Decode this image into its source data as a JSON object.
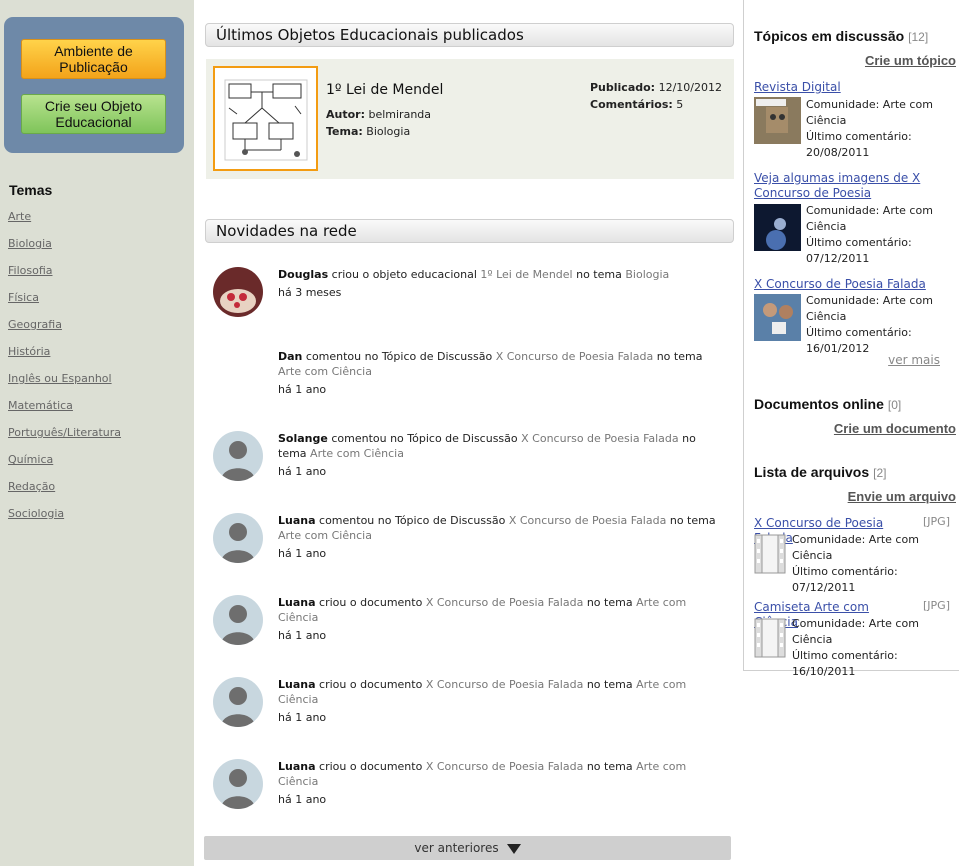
{
  "sidebar": {
    "publish_button": "Ambiente de Publicação",
    "create_button": "Crie seu Objeto Educacional",
    "temas_heading": "Temas",
    "temas": [
      "Arte",
      "Biologia",
      "Filosofia",
      "Física",
      "Geografia",
      "História",
      "Inglês ou Espanhol",
      "Matemática",
      "Português/Literatura",
      "Química",
      "Redação",
      "Sociologia"
    ]
  },
  "objects": {
    "heading": "Últimos Objetos Educacionais publicados",
    "item": {
      "title": "1º Lei de Mendel",
      "autor_label": "Autor:",
      "autor": "belmiranda",
      "tema_label": "Tema:",
      "tema": "Biologia",
      "published_label": "Publicado:",
      "published": "12/10/2012",
      "comments_label": "Comentários:",
      "comments": "5"
    }
  },
  "news": {
    "heading": "Novidades na rede",
    "items": [
      {
        "user": "Douglas",
        "action": "criou o objeto educacional",
        "target": "1º Lei de Mendel",
        "connector": "no tema",
        "theme": "Biologia",
        "time": "há 3 meses",
        "avatar": "photo"
      },
      {
        "user": "Dan",
        "action": "comentou no Tópico de Discussão",
        "target": "X Concurso de Poesia Falada",
        "connector": "no tema",
        "theme": "Arte com Ciência",
        "time": "há 1 ano",
        "avatar": "none"
      },
      {
        "user": "Solange",
        "action": "comentou no Tópico de Discussão",
        "target": "X Concurso de Poesia Falada",
        "connector": "no tema",
        "theme": "Arte com Ciência",
        "time": "há 1 ano",
        "avatar": "default"
      },
      {
        "user": "Luana",
        "action": "comentou no Tópico de Discussão",
        "target": "X Concurso de Poesia Falada",
        "connector": "no tema",
        "theme": "Arte com Ciência",
        "time": "há 1 ano",
        "avatar": "default"
      },
      {
        "user": "Luana",
        "action": "criou o documento",
        "target": "X Concurso de Poesia Falada",
        "connector": "no tema",
        "theme": "Arte com Ciência",
        "time": "há 1 ano",
        "avatar": "default"
      },
      {
        "user": "Luana",
        "action": "criou o documento",
        "target": "X Concurso de Poesia Falada",
        "connector": "no tema",
        "theme": "Arte com Ciência",
        "time": "há 1 ano",
        "avatar": "default"
      },
      {
        "user": "Luana",
        "action": "criou o documento",
        "target": "X Concurso de Poesia Falada",
        "connector": "no tema",
        "theme": "Arte com Ciência",
        "time": "há 1 ano",
        "avatar": "default"
      }
    ],
    "older_button": "ver anteriores"
  },
  "right": {
    "topics": {
      "heading": "Tópicos em discussão",
      "count": "[12]",
      "action": "Crie um tópico",
      "items": [
        {
          "title": "Revista Digital",
          "community": "Comunidade: Arte com Ciência",
          "last": "Último comentário: 20/08/2011"
        },
        {
          "title": "Veja algumas imagens de X Concurso de Poesia",
          "community": "Comunidade: Arte com Ciência",
          "last": "Último comentário: 07/12/2011"
        },
        {
          "title": "X Concurso de Poesia Falada",
          "community": "Comunidade: Arte com Ciência",
          "last": "Último comentário: 16/01/2012"
        }
      ],
      "more": "ver mais"
    },
    "docs": {
      "heading": "Documentos online",
      "count": "[0]",
      "action": "Crie um documento"
    },
    "files": {
      "heading": "Lista de arquivos",
      "count": "[2]",
      "action": "Envie um arquivo",
      "items": [
        {
          "title": "X Concurso de Poesia Falada",
          "type": "[JPG]",
          "community": "Comunidade: Arte com Ciência",
          "last": "Último comentário: 07/12/2011"
        },
        {
          "title": "Camiseta Arte com Ciência",
          "type": "[JPG]",
          "community": "Comunidade: Arte com Ciência",
          "last": "Último comentário: 16/10/2011"
        }
      ]
    }
  }
}
